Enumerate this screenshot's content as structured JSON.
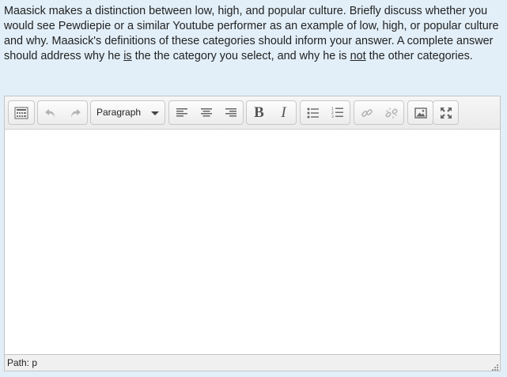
{
  "question": {
    "part1": "Maasick makes a distinction between low, high, and popular culture. Briefly discuss whether you would see Pewdiepie or a similar Youtube performer as an example of low, high, or popular culture and why.  Maasick's definitions of these categories should inform your answer. A complete answer should address why he ",
    "underline1": "is",
    "part2": " the the category you select, and why he is ",
    "underline2": "not",
    "part3": " the other categories."
  },
  "editor": {
    "block_format": "Paragraph",
    "content": "",
    "path_label": "Path: p"
  },
  "toolbar_icons": {
    "toggle": "toolbar-toggle-icon",
    "undo": "undo-icon",
    "redo": "redo-icon",
    "align_left": "align-left-icon",
    "align_center": "align-center-icon",
    "align_right": "align-right-icon",
    "bold": "B",
    "italic": "I",
    "bullets": "bullet-list-icon",
    "numbers": "numbered-list-icon",
    "link": "link-icon",
    "unlink": "unlink-icon",
    "image": "image-icon",
    "fullscreen": "fullscreen-icon"
  },
  "colors": {
    "page_bg": "#e2eff9",
    "text": "#222222",
    "toolbar_bg": "#ebebeb"
  }
}
